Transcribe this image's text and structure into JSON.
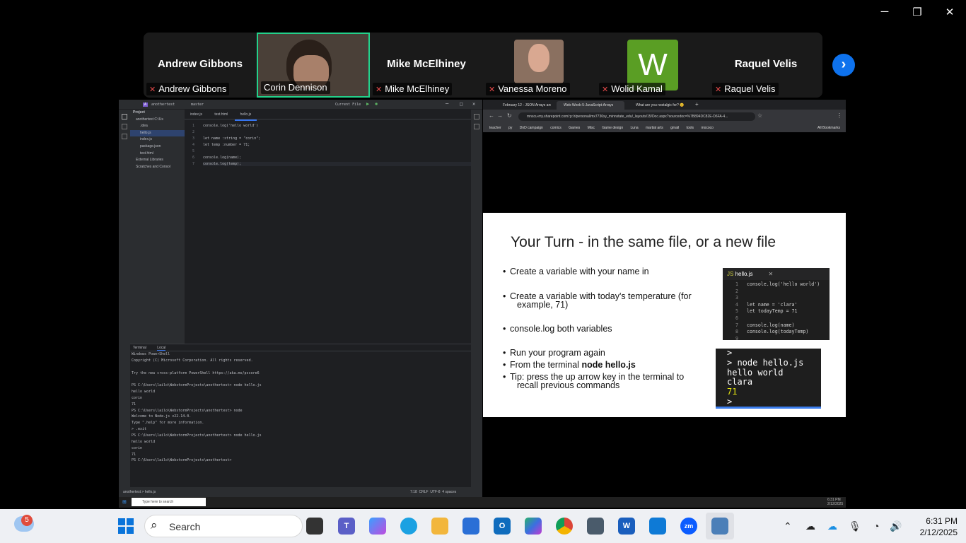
{
  "window_controls": {
    "minimize": "─",
    "restore": "❐",
    "close": "✕"
  },
  "gallery": {
    "participants": [
      {
        "name": "Andrew Gibbons",
        "label": "Andrew Gibbons",
        "muted": true
      },
      {
        "name": "",
        "label": "Corin Dennison",
        "muted": false,
        "active_speaker": true
      },
      {
        "name": "Mike McElhiney",
        "label": "Mike McElhiney",
        "muted": true
      },
      {
        "name": "",
        "label": "Vanessa Moreno",
        "muted": true
      },
      {
        "name": "W",
        "label": "Wolid Kamal",
        "muted": true
      },
      {
        "name": "Raquel Velis",
        "label": "Raquel Velis",
        "muted": true
      }
    ],
    "next_icon": "›",
    "accent": "#0e72ed",
    "speaker_border": "#23d18b",
    "avatar_w_color": "#5a9e24"
  },
  "ide": {
    "project_name": "anothertest",
    "branch": "master",
    "run_config": "Current File",
    "project_label": "Project",
    "tree": [
      "anothertest C:\\Us",
      "  .idea",
      "  hello.js",
      "  index.js",
      "  package.json",
      "  test.html",
      "External Libraries",
      "Scratches and Consol"
    ],
    "tabs": [
      "index.js",
      "test.html",
      "hello.js"
    ],
    "code": [
      {
        "n": "1",
        "t": "console.log('hello world')"
      },
      {
        "n": "2",
        "t": ""
      },
      {
        "n": "3",
        "t": "let name :string = \"corin\";"
      },
      {
        "n": "4",
        "t": "let temp :number = 71;"
      },
      {
        "n": "5",
        "t": ""
      },
      {
        "n": "6",
        "t": "console.log(name);"
      },
      {
        "n": "7",
        "t": "console.log(temp);"
      }
    ],
    "terminal_tabs": [
      "Terminal",
      "Local"
    ],
    "terminal": [
      "Windows PowerShell",
      "Copyright (C) Microsoft Corporation. All rights reserved.",
      "",
      "Try the new cross-platform PowerShell https://aka.ms/pscore6",
      "",
      "PS C:\\Users\\lailo\\WebstormProjects\\anothertest> node hello.js",
      "hello world",
      "corin",
      "71",
      "PS C:\\Users\\lailo\\WebstormProjects\\anothertest> node",
      "Welcome to Node.js v22.14.0.",
      "Type \".help\" for more information.",
      "> .exit",
      "PS C:\\Users\\lailo\\WebstormProjects\\anothertest> node hello.js",
      "hello world",
      "corin",
      "71",
      "PS C:\\Users\\lailo\\WebstormProjects\\anothertest>"
    ],
    "status_path": "anothertest > hello.js",
    "status_right": "7:18  CRLF  UTF-8  4 spaces"
  },
  "browser": {
    "tabs": [
      "February 12 - JSON Arrays and",
      "Web-Week-5-JavaScript-Arrays",
      "What are you nostalgic for? 😊"
    ],
    "url": "mnscu-my.sharepoint.com/:p:/r/personal/mx7736xy_minnstate_edu/_layouts/15/Doc.aspx?sourcedoc=%7B894DC82E-D6FA-4...",
    "bookmarks": [
      "teacher",
      "py",
      "DnD campaign",
      "comics",
      "Games",
      "Misc",
      "Game design",
      "Luna",
      "martial arts",
      "gmail",
      "tools",
      "mococo"
    ],
    "all_bookmarks": "All Bookmarks"
  },
  "slide": {
    "title": "Your Turn - in the same file, or a new file",
    "bullets": [
      "Create a variable with your name in",
      "Create a variable with today's temperature (for",
      "example, 71)",
      "console.log both variables",
      "Run your program again",
      "From the terminal",
      "node hello.js",
      "Tip: press the up arrow key in the terminal to",
      "recall previous commands"
    ],
    "code_tab": "hello.js",
    "code_lines": [
      {
        "n": "1",
        "t": "console.log('hello world')"
      },
      {
        "n": "2",
        "t": ""
      },
      {
        "n": "3",
        "t": ""
      },
      {
        "n": "4",
        "t": "let name = 'clara'"
      },
      {
        "n": "5",
        "t": "let todayTemp = 71"
      },
      {
        "n": "6",
        "t": ""
      },
      {
        "n": "7",
        "t": "console.log(name)"
      },
      {
        "n": "8",
        "t": "console.log(todayTemp)"
      },
      {
        "n": "9",
        "t": ""
      }
    ],
    "terminal_lines": [
      ">",
      "> node hello.js",
      "hello world",
      "clara",
      "71",
      "> "
    ]
  },
  "inner_taskbar": {
    "search": "Type here to search",
    "time": "6:31 PM",
    "date": "2/12/2025"
  },
  "taskbar": {
    "weather_badge": "5",
    "search": "Search",
    "apps": [
      "Task View",
      "Teams",
      "Copilot",
      "Edge",
      "File Explorer",
      "Store",
      "Outlook",
      "M365",
      "Chrome",
      "Calculator",
      "Word",
      "VS Code",
      "Zoom",
      "Remote Desktop"
    ],
    "time": "6:31 PM",
    "date": "2/12/2025"
  }
}
